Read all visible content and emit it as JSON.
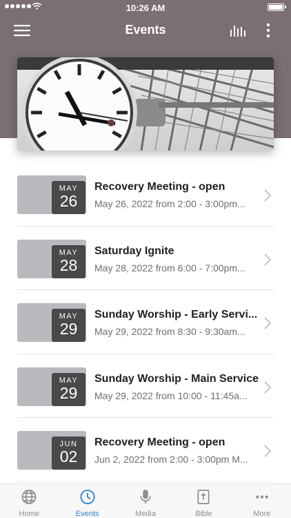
{
  "status_bar": {
    "time": "10:26 AM"
  },
  "header": {
    "title": "Events"
  },
  "icons": {
    "menu": "menu-icon",
    "chart": "bar-chart-icon",
    "more": "more-vertical-icon",
    "chevron": "chevron-right-icon"
  },
  "colors": {
    "header_bg": "#7b6f72",
    "accent": "#2f86d6",
    "date_box": "#49494b",
    "thumb": "#b9babd"
  },
  "events": [
    {
      "month": "MAY",
      "day": "26",
      "title": "Recovery Meeting - open",
      "subtitle": "May 26, 2022 from 2:00 - 3:00pm..."
    },
    {
      "month": "MAY",
      "day": "28",
      "title": "Saturday Ignite",
      "subtitle": "May 28, 2022 from 6:00 - 7:00pm..."
    },
    {
      "month": "MAY",
      "day": "29",
      "title": "Sunday Worship - Early Servi...",
      "subtitle": "May 29, 2022 from 8:30 - 9:30am..."
    },
    {
      "month": "MAY",
      "day": "29",
      "title": "Sunday Worship - Main Service",
      "subtitle": "May 29, 2022 from 10:00 - 11:45a..."
    },
    {
      "month": "JUN",
      "day": "02",
      "title": "Recovery Meeting - open",
      "subtitle": "Jun 2, 2022 from 2:00 - 3:00pm M..."
    }
  ],
  "tabs": [
    {
      "label": "Home",
      "icon": "globe-icon",
      "active": false
    },
    {
      "label": "Events",
      "icon": "clock-icon",
      "active": true
    },
    {
      "label": "Media",
      "icon": "microphone-icon",
      "active": false
    },
    {
      "label": "Bible",
      "icon": "bible-icon",
      "active": false
    },
    {
      "label": "More",
      "icon": "more-horizontal-icon",
      "active": false
    }
  ]
}
